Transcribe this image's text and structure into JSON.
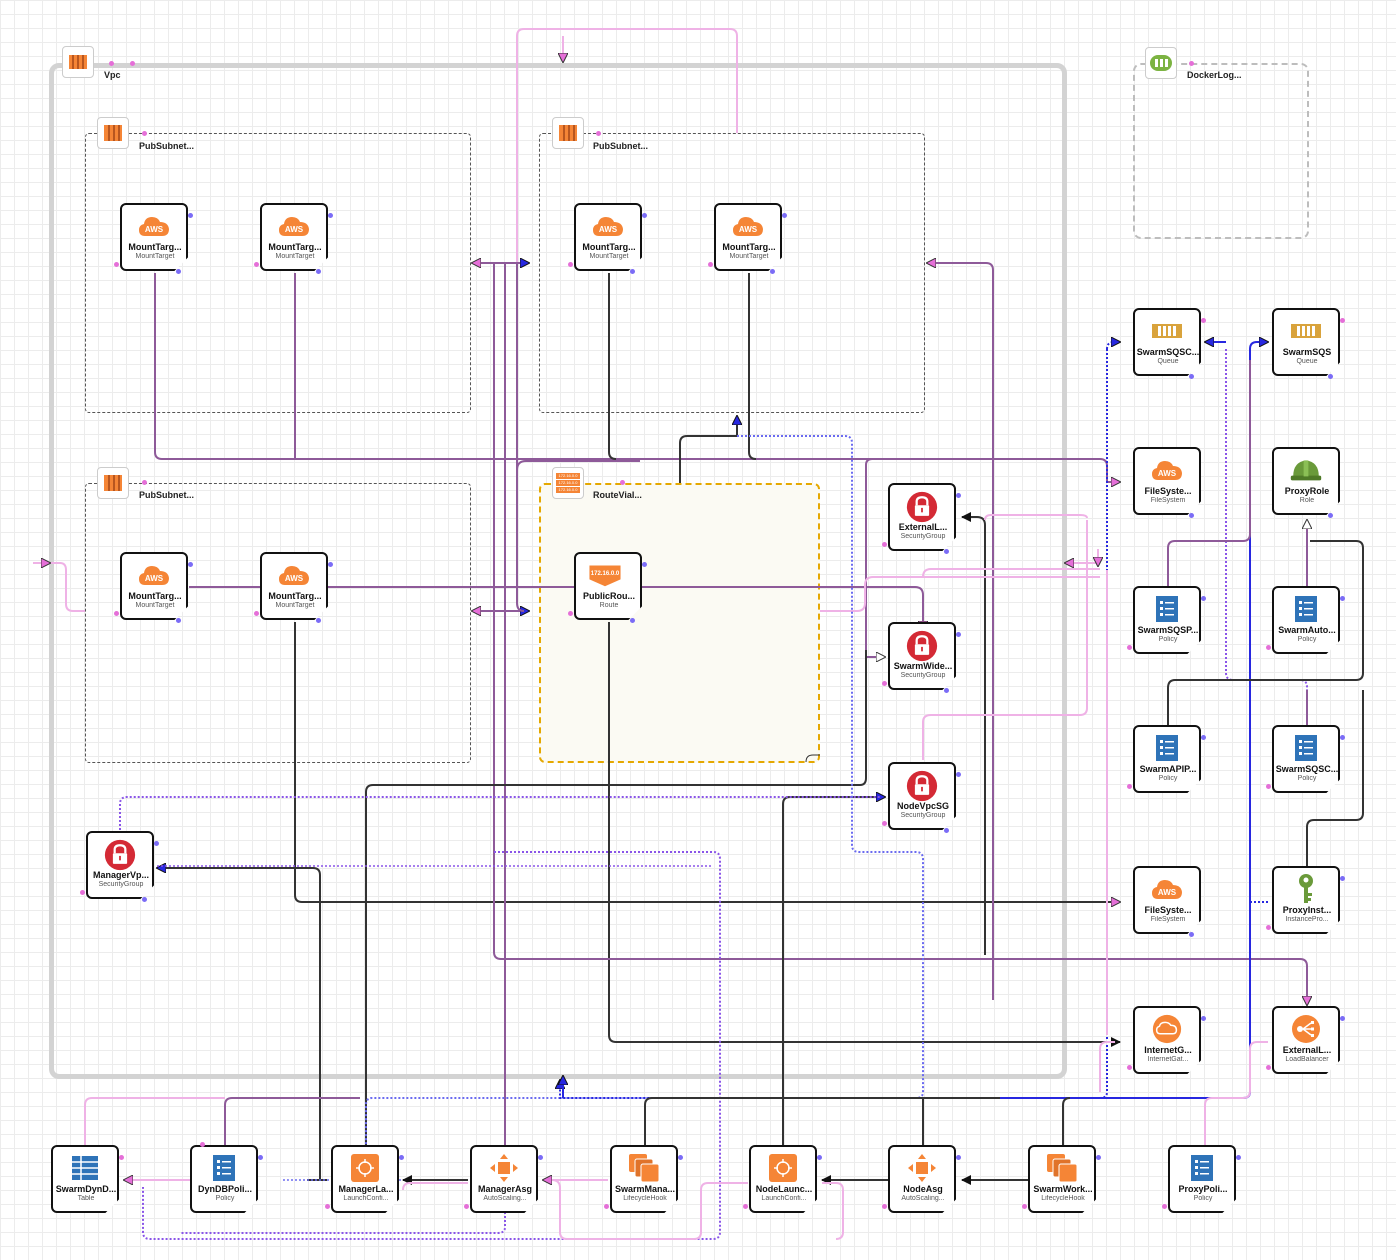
{
  "containers": {
    "vpc": {
      "label": "Vpc",
      "icon": "aws-vpc-icon"
    },
    "pubsubnet_a": {
      "label": "PubSubnet..."
    },
    "pubsubnet_b": {
      "label": "PubSubnet..."
    },
    "pubsubnet_c": {
      "label": "PubSubnet..."
    },
    "routetable": {
      "label": "RouteViaI...",
      "icon_text": [
        "172.16.0.0",
        "172.16.0.0",
        "172.16.0.0"
      ]
    },
    "loggroup": {
      "label": "DockerLog..."
    }
  },
  "nodes": {
    "mt1": {
      "title": "MountTarg...",
      "sub": "MountTarget",
      "icon_text": "AWS"
    },
    "mt2": {
      "title": "MountTarg...",
      "sub": "MountTarget",
      "icon_text": "AWS"
    },
    "mt3": {
      "title": "MountTarg...",
      "sub": "MountTarget",
      "icon_text": "AWS"
    },
    "mt4": {
      "title": "MountTarg...",
      "sub": "MountTarget",
      "icon_text": "AWS"
    },
    "mt5": {
      "title": "MountTarg...",
      "sub": "MountTarget",
      "icon_text": "AWS"
    },
    "mt6": {
      "title": "MountTarg...",
      "sub": "MountTarget",
      "icon_text": "AWS"
    },
    "route": {
      "title": "PublicRou...",
      "sub": "Route",
      "icon_text": "172.16.0.0"
    },
    "sg_external": {
      "title": "ExternalL...",
      "sub": "SecurityGroup"
    },
    "sg_swarmwide": {
      "title": "SwarmWide...",
      "sub": "SecurityGroup"
    },
    "sg_nodevpc": {
      "title": "NodeVpcSG",
      "sub": "SecurityGroup"
    },
    "sg_managervpc": {
      "title": "ManagerVp...",
      "sub": "SecurityGroup"
    },
    "queue1": {
      "title": "SwarmSQSC...",
      "sub": "Queue"
    },
    "queue2": {
      "title": "SwarmSQS",
      "sub": "Queue"
    },
    "fs1": {
      "title": "FileSyste...",
      "sub": "FileSystem",
      "icon_text": "AWS"
    },
    "fs2": {
      "title": "FileSyste...",
      "sub": "FileSystem",
      "icon_text": "AWS"
    },
    "proxyrole": {
      "title": "ProxyRole",
      "sub": "Role"
    },
    "pol_sqsp": {
      "title": "SwarmSQSP...",
      "sub": "Policy"
    },
    "pol_auto": {
      "title": "SwarmAuto...",
      "sub": "Policy"
    },
    "pol_api": {
      "title": "SwarmAPIP...",
      "sub": "Policy"
    },
    "pol_sqsc": {
      "title": "SwarmSQSC...",
      "sub": "Policy"
    },
    "proxyinst": {
      "title": "ProxyInst...",
      "sub": "InstancePro..."
    },
    "igw": {
      "title": "InternetG...",
      "sub": "InternetGat..."
    },
    "elb": {
      "title": "ExternalL...",
      "sub": "LoadBalancer"
    },
    "dyndb": {
      "title": "SwarmDynD...",
      "sub": "Table"
    },
    "dyndbpol": {
      "title": "DynDBPoli...",
      "sub": "Policy"
    },
    "mgrlc": {
      "title": "ManagerLa...",
      "sub": "LaunchConfi..."
    },
    "mgrasg": {
      "title": "ManagerAsg",
      "sub": "AutoScaling..."
    },
    "mgrhook": {
      "title": "SwarmMana...",
      "sub": "LifecycleHook"
    },
    "nodelc": {
      "title": "NodeLaunc...",
      "sub": "LaunchConfi..."
    },
    "nodeasg": {
      "title": "NodeAsg",
      "sub": "AutoScaling..."
    },
    "wrkhook": {
      "title": "SwarmWork...",
      "sub": "LifecycleHook"
    },
    "proxypol": {
      "title": "ProxyPoli...",
      "sub": "Policy"
    }
  },
  "icons": {
    "mountTarget": "aws-cloud-icon",
    "securityGroup": "padlock-icon",
    "queue": "queue-icon",
    "fileSystem": "aws-cloud-icon",
    "role": "hardhat-icon",
    "policy": "document-list-icon",
    "instanceProfile": "key-icon",
    "internetGateway": "cloud-gateway-icon",
    "loadBalancer": "load-balancer-icon",
    "table": "table-icon",
    "launchConfig": "launch-config-icon",
    "autoScaling": "autoscaling-icon",
    "lifecycleHook": "lifecycle-hook-icon",
    "route": "route-badge-icon",
    "subnet": "aws-stack-icon",
    "logGroup": "log-group-icon"
  },
  "colors": {
    "awsOrange": "#f58536",
    "securityRed": "#d42a35",
    "queueGold": "#d9a33c",
    "policyBlue": "#2e73b8",
    "roleGreen": "#6a9a3a",
    "wirePurple": "#8e5a99",
    "wirePink": "#efb2e6",
    "wireDark": "#333333",
    "wireBlue": "#2727e0",
    "wireViolet": "#8a55e8"
  }
}
